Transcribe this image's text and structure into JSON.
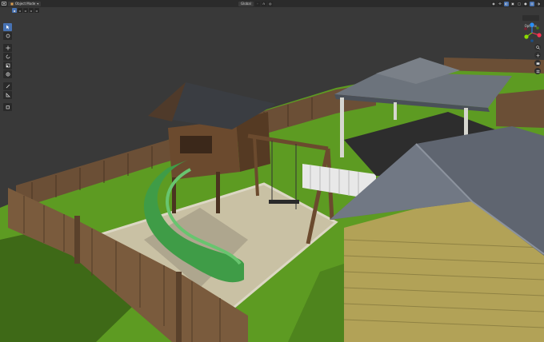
{
  "header": {
    "editor_icon": "3d-viewport-icon",
    "mode": "Object Mode",
    "orientation": "Global",
    "options": "Options"
  },
  "toolbar": {
    "tools": [
      "select-box-icon",
      "cursor-icon",
      "move-icon",
      "rotate-icon",
      "scale-icon",
      "transform-icon",
      "annotate-icon",
      "measure-icon",
      "add-cube-icon"
    ]
  },
  "gizmo": {
    "axes": [
      "X",
      "Y",
      "Z"
    ],
    "colors": {
      "x": "#ff3352",
      "y": "#8bdc00",
      "z": "#2890ff"
    }
  },
  "nav": [
    "zoom-icon",
    "pan-icon",
    "camera-icon",
    "ortho-grid-icon"
  ],
  "colors": {
    "background": "#393939",
    "grass": "#5d9b22",
    "fence": "#6b4f36",
    "slide": "#3f9c47",
    "shed_wall": "#b2a257",
    "roof": "#5f6570"
  }
}
